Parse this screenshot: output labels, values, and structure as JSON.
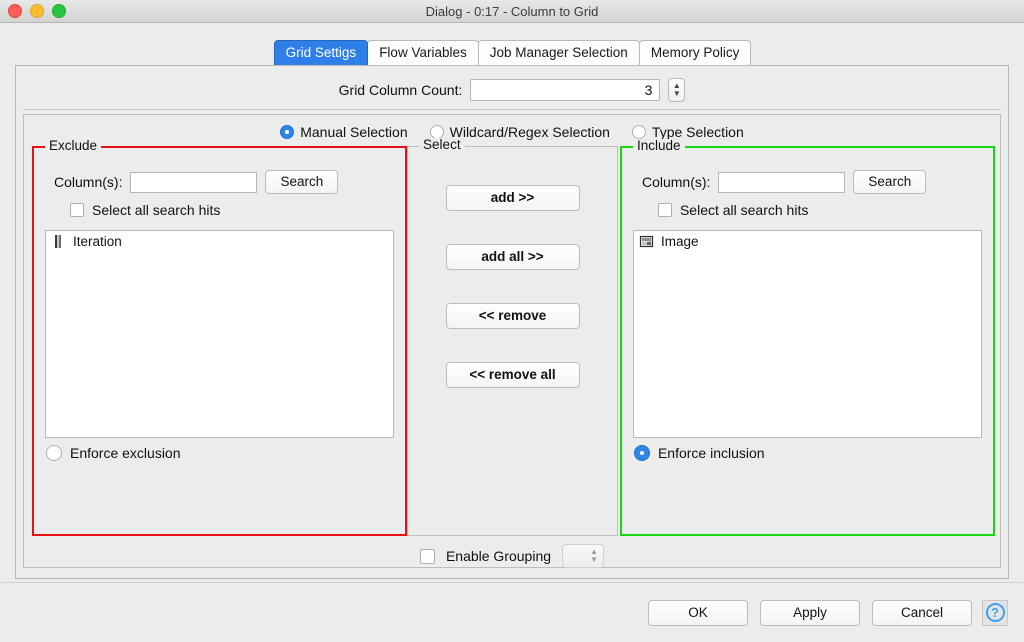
{
  "window": {
    "title": "Dialog - 0:17 - Column to Grid",
    "traffic_lights": [
      "close-button",
      "minimize-button",
      "zoom-button"
    ]
  },
  "tabs": [
    {
      "label": "Grid Settigs",
      "active": true
    },
    {
      "label": "Flow Variables",
      "active": false
    },
    {
      "label": "Job Manager Selection",
      "active": false
    },
    {
      "label": "Memory Policy",
      "active": false
    }
  ],
  "grid_column_count": {
    "label": "Grid Column Count:",
    "value": "3"
  },
  "selection_modes": [
    {
      "label": "Manual Selection",
      "selected": true
    },
    {
      "label": "Wildcard/Regex Selection",
      "selected": false
    },
    {
      "label": "Type Selection",
      "selected": false
    }
  ],
  "exclude": {
    "title": "Exclude",
    "border_color": "#e81010",
    "columns_label": "Column(s):",
    "search_value": "",
    "search_placeholder": "",
    "search_button": "Search",
    "select_all_hits_label": "Select all search hits",
    "select_all_hits_checked": false,
    "items": [
      {
        "label": "Iteration",
        "icon": "integer-type-icon"
      }
    ],
    "enforce_label": "Enforce exclusion",
    "enforce_selected": false
  },
  "select": {
    "title": "Select",
    "buttons": [
      {
        "label": "add >>",
        "name": "add-button"
      },
      {
        "label": "add all >>",
        "name": "add-all-button"
      },
      {
        "label": "<< remove",
        "name": "remove-button"
      },
      {
        "label": "<< remove all",
        "name": "remove-all-button"
      }
    ]
  },
  "include": {
    "title": "Include",
    "border_color": "#14d814",
    "columns_label": "Column(s):",
    "search_value": "",
    "search_placeholder": "",
    "search_button": "Search",
    "select_all_hits_label": "Select all search hits",
    "select_all_hits_checked": false,
    "items": [
      {
        "label": "Image",
        "icon": "image-type-icon"
      }
    ],
    "enforce_label": "Enforce inclusion",
    "enforce_selected": true
  },
  "grouping": {
    "label": "Enable Grouping",
    "checked": false,
    "spinner_value": ""
  },
  "footer": {
    "ok": "OK",
    "apply": "Apply",
    "cancel": "Cancel",
    "help": "?"
  }
}
